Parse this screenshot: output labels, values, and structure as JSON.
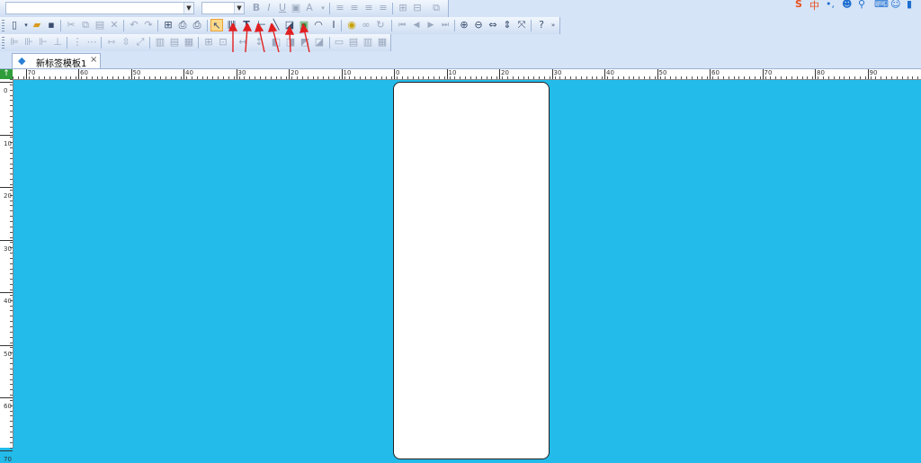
{
  "toolbar": {
    "font_name_value": "",
    "font_size_value": "",
    "format_icons": [
      "bold-icon",
      "italic-icon",
      "underline-icon",
      "background-color-icon",
      "font-color-icon"
    ],
    "align_icons": [
      "align-left-icon",
      "align-center-icon",
      "align-right-icon",
      "justify-icon"
    ],
    "standard_icons": [
      "new-file-icon",
      "open-folder-icon",
      "save-icon",
      "cut-icon",
      "copy-icon",
      "paste-icon",
      "delete-icon",
      "undo-icon",
      "redo-icon",
      "table-icon",
      "print-preview-icon",
      "print-icon"
    ],
    "tools": [
      {
        "id": "select",
        "icon": "cursor-arrow-icon",
        "selected": true
      },
      {
        "id": "barcode",
        "icon": "barcode-icon",
        "selected": false
      },
      {
        "id": "text",
        "icon": "text-icon",
        "selected": false
      },
      {
        "id": "line",
        "icon": "line-icon",
        "selected": false
      },
      {
        "id": "diagonal",
        "icon": "diagonal-line-icon",
        "selected": false
      },
      {
        "id": "shape",
        "icon": "shape-icon",
        "selected": false
      },
      {
        "id": "image",
        "icon": "image-icon",
        "selected": false
      },
      {
        "id": "rfid",
        "icon": "rfid-icon",
        "selected": false
      },
      {
        "id": "cursor-text",
        "icon": "i-beam-icon",
        "selected": false
      }
    ],
    "nav_icons": [
      "database-icon",
      "binoculars-icon",
      "refresh-icon",
      "first-icon",
      "prev-icon",
      "next-icon",
      "last-icon"
    ],
    "zoom_icons": [
      "zoom-in-icon",
      "zoom-out-icon",
      "fit-width-icon",
      "fit-height-icon",
      "fit-page-icon",
      "help-icon"
    ]
  },
  "tabs": [
    {
      "label": "新标签模板1",
      "close": "×"
    }
  ],
  "ruler": {
    "h_labels": [
      "70",
      "60",
      "50",
      "40",
      "30",
      "20",
      "10",
      "0",
      "10",
      "20",
      "30",
      "40",
      "50",
      "60",
      "70",
      "80",
      "90"
    ],
    "v_labels": [
      "0",
      "10",
      "20",
      "30",
      "40",
      "50",
      "60",
      "70"
    ]
  },
  "colors": {
    "workspace": "#22bbea",
    "label": "#ffffff",
    "hint_arrows": "#e02020"
  }
}
